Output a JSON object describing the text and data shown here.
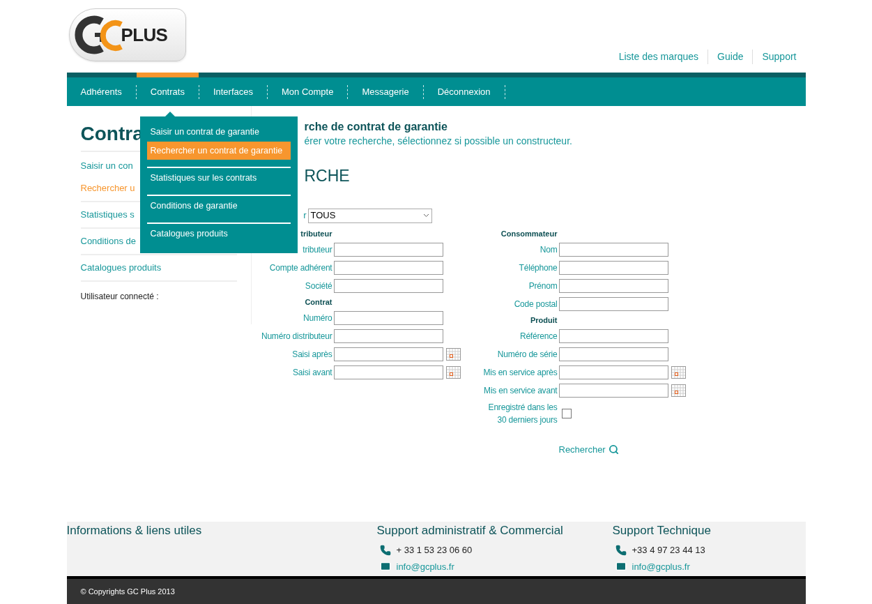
{
  "logo": {
    "text": "PLUS"
  },
  "top_links": [
    "Liste des marques",
    "Guide",
    "Support"
  ],
  "nav": [
    {
      "label": "Adhérents",
      "selected": false
    },
    {
      "label": "Contrats",
      "selected": true
    },
    {
      "label": "Interfaces",
      "selected": false
    },
    {
      "label": "Mon Compte",
      "selected": false
    },
    {
      "label": "Messagerie",
      "selected": false
    },
    {
      "label": "Déconnexion",
      "selected": false
    }
  ],
  "dropdown": [
    {
      "label": "Saisir un contrat de garantie",
      "selected": false
    },
    {
      "label": "Rechercher un contrat de garantie",
      "selected": true
    },
    {
      "label": "Statistiques sur les contrats",
      "selected": false
    },
    {
      "label": "Conditions de garantie",
      "selected": false
    },
    {
      "label": "Catalogues produits",
      "selected": false
    }
  ],
  "sidebar": {
    "title": "Contra",
    "items": [
      {
        "label": "Saisir un con",
        "selected": false
      },
      {
        "label": "Rechercher u",
        "selected": true
      },
      {
        "label": "Statistiques s",
        "selected": false
      },
      {
        "label": "Conditions de",
        "selected": false
      },
      {
        "label": "Catalogues produits",
        "selected": false
      }
    ],
    "user_label": "Utilisateur connecté :"
  },
  "main": {
    "title": "rche de contrat de garantie",
    "subtitle": "érer votre recherche, sélectionnez si possible un constructeur.",
    "section": "RCHE",
    "filter": {
      "label": "r",
      "value": "TOUS"
    },
    "columns": [
      [
        {
          "heading": "tributeur",
          "fields": [
            {
              "label": "tributeur",
              "kind": "text"
            },
            {
              "label": "Compte adhérent",
              "kind": "text"
            },
            {
              "label": "Société",
              "kind": "text"
            }
          ]
        },
        {
          "heading": "Contrat",
          "fields": [
            {
              "label": "Numéro",
              "kind": "text"
            },
            {
              "label": "Numéro distributeur",
              "kind": "text"
            },
            {
              "label": "Saisi après",
              "kind": "date"
            },
            {
              "label": "Saisi avant",
              "kind": "date"
            }
          ]
        }
      ],
      [
        {
          "heading": "Consommateur",
          "fields": [
            {
              "label": "Nom",
              "kind": "text"
            },
            {
              "label": "Téléphone",
              "kind": "text"
            },
            {
              "label": "Prénom",
              "kind": "text"
            },
            {
              "label": "Code postal",
              "kind": "text"
            }
          ]
        },
        {
          "heading": "Produit",
          "fields": [
            {
              "label": "Référence",
              "kind": "text"
            },
            {
              "label": "Numéro de série",
              "kind": "text"
            },
            {
              "label": "Mis en service après",
              "kind": "date"
            },
            {
              "label": "Mis en service avant",
              "kind": "date"
            },
            {
              "label": "Enregistré dans les 30 derniers jours",
              "kind": "checkbox",
              "checked": false
            }
          ]
        }
      ]
    ],
    "search_button": "Rechercher"
  },
  "footer": {
    "columns": [
      {
        "title": "Informations & liens utiles"
      },
      {
        "title": "Support administratif & Commercial",
        "phone": "+ 33 1 53 23 06 60",
        "email": "info@gcplus.fr"
      },
      {
        "title": "Support Technique",
        "phone": "+33 4 97 23 44 13",
        "email": "info@gcplus.fr"
      }
    ],
    "copyright": "© Copyrights GC Plus 2013"
  }
}
